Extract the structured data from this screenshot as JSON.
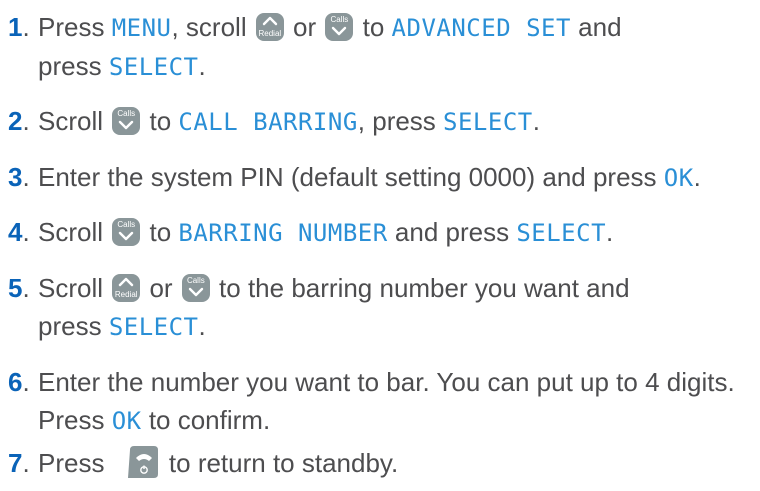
{
  "colors": {
    "number": "#0a63b8",
    "text": "#4d4d4f",
    "lcd": "#2a8fd6",
    "key": "#8a9699"
  },
  "keys": {
    "redial_label": "Redial",
    "calls_label": "Calls"
  },
  "steps": [
    {
      "num": "1",
      "dot": ".",
      "a": "Press ",
      "b": "MENU",
      "c": ", scroll ",
      "d": " or ",
      "e": " to ",
      "f": "ADVANCED SET",
      "g": " and",
      "h": "press ",
      "i": "SELECT",
      "j": "."
    },
    {
      "num": "2",
      "dot": ".",
      "a": "Scroll ",
      "b": " to ",
      "c": "CALL BARRING",
      "d": ", press ",
      "e": "SELECT",
      "f": "."
    },
    {
      "num": "3",
      "dot": ".",
      "a": "Enter the system PIN (default setting 0000) and press ",
      "b": "OK",
      "c": "."
    },
    {
      "num": "4",
      "dot": ".",
      "a": "Scroll ",
      "b": " to ",
      "c": "BARRING NUMBER",
      "d": " and press ",
      "e": "SELECT",
      "f": "."
    },
    {
      "num": "5",
      "dot": ".",
      "a": "Scroll ",
      "b": " or ",
      "c": " to the barring number you want and",
      "d": "press ",
      "e": "SELECT",
      "f": "."
    },
    {
      "num": "6",
      "dot": ".",
      "a": "Enter the number you want to bar. You can put up to 4 digits.",
      "b": "Press ",
      "c": "OK",
      "d": " to confirm."
    },
    {
      "num": "7",
      "dot": ".",
      "a": "Press ",
      "b": " to return to standby."
    }
  ]
}
